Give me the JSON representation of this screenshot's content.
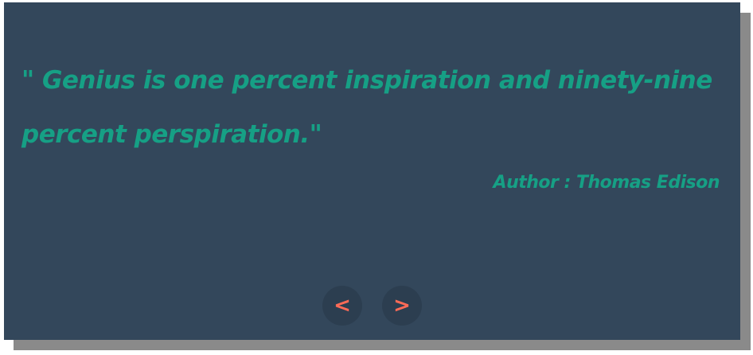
{
  "quote": {
    "text": "\" Genius is one percent inspiration and ninety-nine percent perspiration.\"",
    "author": "Author : Thomas Edison"
  },
  "nav": {
    "prev_label": "<",
    "next_label": ">"
  },
  "colors": {
    "card_background": "#33475b",
    "shadow": "#8a8a8a",
    "quote_text": "#16a085",
    "button_background": "#2c3e50",
    "button_text": "#ff6b57"
  }
}
